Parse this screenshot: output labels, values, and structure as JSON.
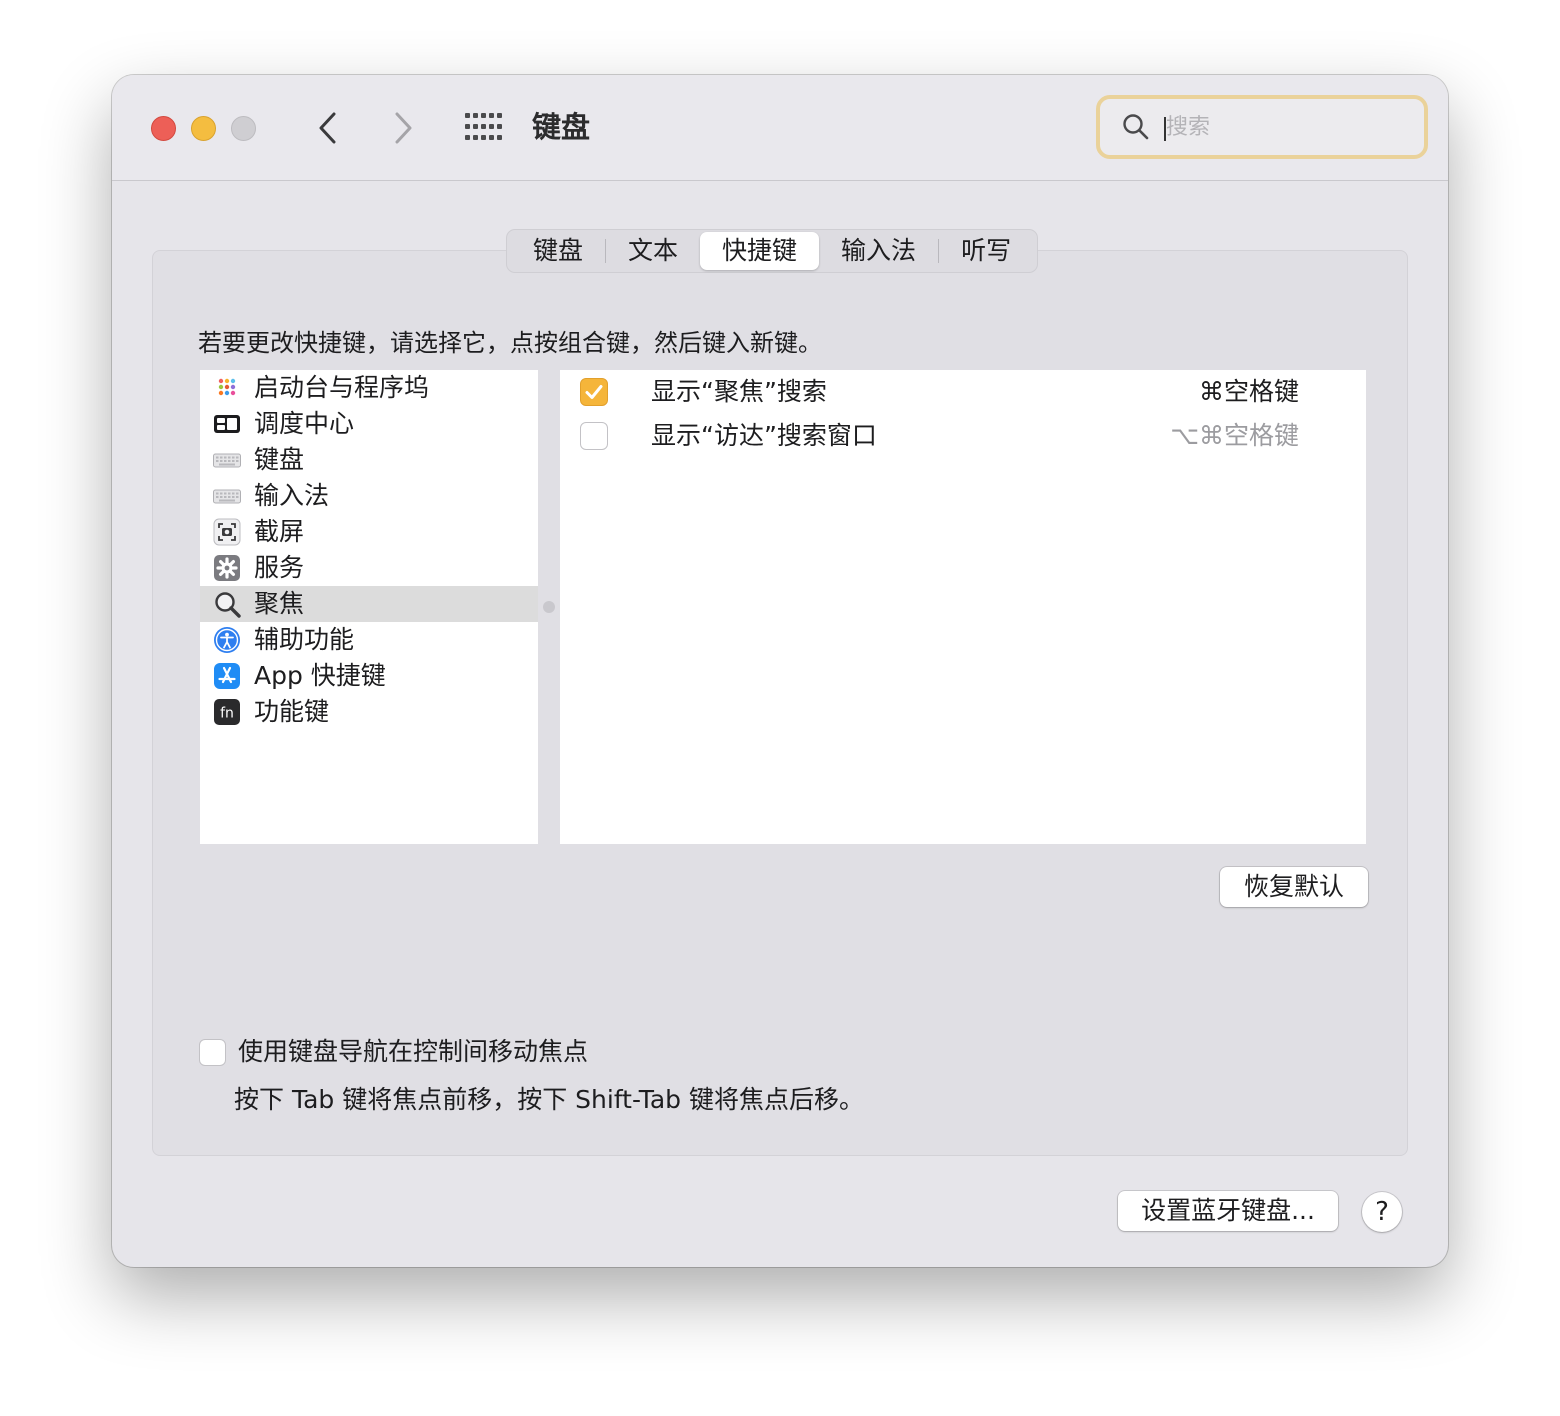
{
  "window": {
    "title": "键盘",
    "search": {
      "placeholder": "搜索",
      "value": ""
    }
  },
  "tabs": [
    {
      "label": "键盘",
      "active": false
    },
    {
      "label": "文本",
      "active": false
    },
    {
      "label": "快捷键",
      "active": true
    },
    {
      "label": "输入法",
      "active": false
    },
    {
      "label": "听写",
      "active": false
    }
  ],
  "instruction": "若要更改快捷键，请选择它，点按组合键，然后键入新键。",
  "categories": [
    {
      "label": "启动台与程序坞",
      "icon": "launchpad-icon",
      "selected": false
    },
    {
      "label": "调度中心",
      "icon": "mission-control-icon",
      "selected": false
    },
    {
      "label": "键盘",
      "icon": "keyboard-icon",
      "selected": false
    },
    {
      "label": "输入法",
      "icon": "keyboard-icon",
      "selected": false
    },
    {
      "label": "截屏",
      "icon": "screenshot-icon",
      "selected": false
    },
    {
      "label": "服务",
      "icon": "gear-icon",
      "selected": false
    },
    {
      "label": "聚焦",
      "icon": "magnifier-icon",
      "selected": true
    },
    {
      "label": "辅助功能",
      "icon": "accessibility-icon",
      "selected": false
    },
    {
      "label": "App 快捷键",
      "icon": "app-store-icon",
      "selected": false
    },
    {
      "label": "功能键",
      "icon": "fn-key-icon",
      "selected": false
    }
  ],
  "shortcuts": [
    {
      "label": "显示“聚焦”搜索",
      "key": "⌘空格键",
      "checked": true
    },
    {
      "label": "显示“访达”搜索窗口",
      "key": "⌥⌘空格键",
      "checked": false
    }
  ],
  "buttons": {
    "restore": "恢复默认",
    "bluetooth": "设置蓝牙键盘...",
    "help": "?"
  },
  "keyboard_navigation": {
    "label": "使用键盘导航在控制间移动焦点",
    "hint": "按下 Tab 键将焦点前移，按下 Shift-Tab 键将焦点后移。",
    "checked": false
  },
  "colors": {
    "accent": "#f5b53a",
    "close": "#ed5f57",
    "minimize": "#f4bd40",
    "zoom": "#cfced2",
    "search_focus_ring": "#ead29a"
  }
}
